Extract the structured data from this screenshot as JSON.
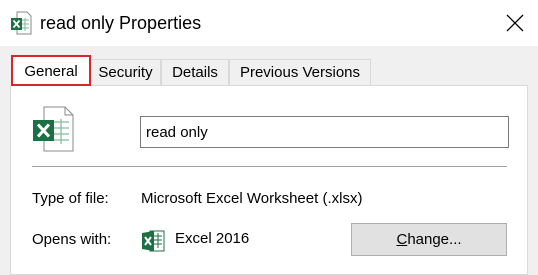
{
  "window": {
    "title": "read only Properties",
    "title_icon": "excel-file-icon",
    "close_icon": "close-icon"
  },
  "tabs": [
    {
      "label": "General",
      "active": true
    },
    {
      "label": "Security",
      "active": false
    },
    {
      "label": "Details",
      "active": false
    },
    {
      "label": "Previous Versions",
      "active": false
    }
  ],
  "general": {
    "file_icon": "excel-file-icon",
    "file_name_value": "read only",
    "type_label": "Type of file:",
    "type_value": "Microsoft Excel Worksheet (.xlsx)",
    "opens_label": "Opens with:",
    "opens_app_icon": "excel-app-icon",
    "opens_value": "Excel 2016",
    "change_button": {
      "mnemonic": "C",
      "rest": "hange..."
    }
  },
  "colors": {
    "excel_green": "#1d7044",
    "highlight_red": "#d9262c",
    "panel_bg": "#ffffff",
    "window_bg": "#f0f0f0"
  }
}
